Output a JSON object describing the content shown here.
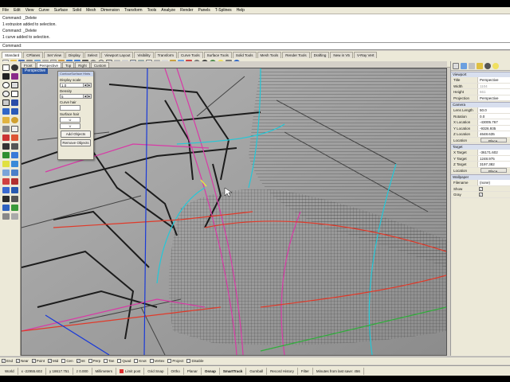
{
  "menu": [
    "File",
    "Edit",
    "View",
    "Curve",
    "Surface",
    "Solid",
    "Mesh",
    "Dimension",
    "Transform",
    "Tools",
    "Analyze",
    "Render",
    "Panels",
    "T-Splines",
    "Help"
  ],
  "command_history": [
    "Command: _Delete",
    "1 extrusion added to selection.",
    "Command: _Delete",
    "1 curve added to selection."
  ],
  "command_prompt": "Command:",
  "toolbar_tabs": [
    "Standard",
    "CPlanes",
    "Set View",
    "Display",
    "Select",
    "Viewport Layout",
    "Visibility",
    "Transform",
    "Curve Tools",
    "Surface Tools",
    "Solid Tools",
    "Mesh Tools",
    "Render Tools",
    "Drafting",
    "New in V5",
    "V-Ray Vert"
  ],
  "viewport_tabs": [
    "Front",
    "Perspective",
    "Top",
    "Right",
    "Custom"
  ],
  "viewport_label": "Perspective",
  "dialog": {
    "title": "ContourSurface Hints",
    "display_scale_label": "Display scale",
    "display_scale_value": "1.0",
    "density_label": "Density",
    "density_value": "5",
    "curve_hair_label": "Curve hair",
    "surface_hair_label": "Surface hair",
    "surface_u": "U",
    "surface_v": "V",
    "add_objects": "Add Objects",
    "remove_objects": "Remove Objects"
  },
  "properties": {
    "viewport_section": "Viewport",
    "title_key": "Title",
    "title_val": "Perspective",
    "width_key": "Width",
    "width_val": "1104",
    "height_key": "Height",
    "height_val": "661",
    "projection_key": "Projection",
    "projection_val": "Perspective",
    "camera_section": "Camera",
    "lens_key": "Lens Length",
    "lens_val": "50.0",
    "rotation_key": "Rotation",
    "rotation_val": "0.0",
    "xloc_key": "X Location",
    "xloc_val": "-43005.767",
    "yloc_key": "Y Location",
    "yloc_val": "-9326.935",
    "zloc_key": "Z Location",
    "zloc_val": "4648.635",
    "location_key": "Location",
    "location_btn": "Place...",
    "target_section": "Target",
    "xt_key": "X Target",
    "xt_val": "-36171.602",
    "yt_key": "Y Target",
    "yt_val": "1248.975",
    "zt_key": "Z Target",
    "zt_val": "3197.382",
    "tloc_key": "Location",
    "tloc_btn": "Place...",
    "wallpaper_section": "Wallpaper",
    "filename_key": "Filename",
    "filename_val": "(none)",
    "show_key": "Show",
    "gray_key": "Gray"
  },
  "osnaps": [
    "End",
    "Near",
    "Point",
    "Mid",
    "Cen",
    "Int",
    "Perp",
    "Tan",
    "Quad",
    "Knot",
    "Vertex",
    "Project",
    "Disable"
  ],
  "status": {
    "cplane": "World",
    "x": "x -22955.602",
    "y": "y 18617.751",
    "z": "z 0.000",
    "units": "Millimeters",
    "layer": "Limit post",
    "grid_snap": "Grid Snap",
    "ortho": "Ortho",
    "planar": "Planar",
    "osnap": "Osnap",
    "smarttrack": "SmartTrack",
    "gumball": "Gumball",
    "record_history": "Record History",
    "filter": "Filter",
    "autosave": "Minutes from last save: 456"
  },
  "colors": {
    "viewport_bg": "#9a9a9a",
    "accent_blue": "#2d58a6",
    "magenta": "#d83aa6",
    "cyan": "#22c8d8",
    "red": "#e03a2a"
  }
}
